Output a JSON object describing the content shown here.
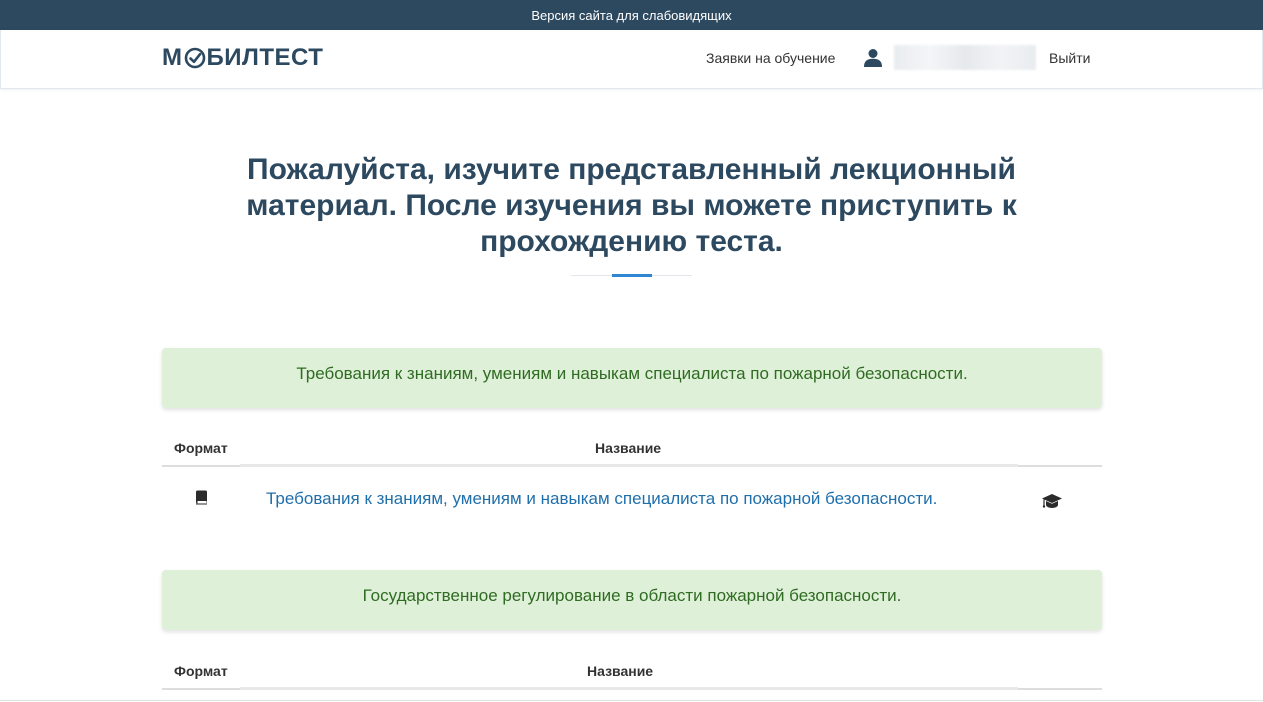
{
  "topbar": {
    "accessibility_label": "Версия сайта для слабовидящих"
  },
  "navbar": {
    "logo_text_left": "М",
    "logo_text_right": "БИЛТЕСТ",
    "logo_full": "МОБИЛТЕСТ",
    "training_requests_label": "Заявки на обучение",
    "logout_label": "Выйти",
    "user_icon": "user-icon"
  },
  "hero": {
    "title": "Пожалуйста, изучите представленный лекционный материал. После изучения вы можете приступить к прохождению теста."
  },
  "sections": [
    {
      "banner": "Требования к знаниям, умениям и навыкам специалиста по пожарной безопасности.",
      "columns": {
        "format": "Формат",
        "name": "Название"
      },
      "rows": [
        {
          "format_icon": "book-icon",
          "title": "Требования к знаниям, умениям и навыкам специалиста по пожарной безопасности.",
          "action_icon": "graduation-cap-icon"
        }
      ]
    },
    {
      "banner": "Государственное регулирование в области пожарной безопасности.",
      "columns": {
        "format": "Формат",
        "name": "Название"
      },
      "rows": []
    }
  ],
  "colors": {
    "brand": "#2d4960",
    "accent": "#2f86d2",
    "success_bg": "#dff0d8",
    "success_text": "#2f6b22",
    "link": "#1f6fab"
  }
}
